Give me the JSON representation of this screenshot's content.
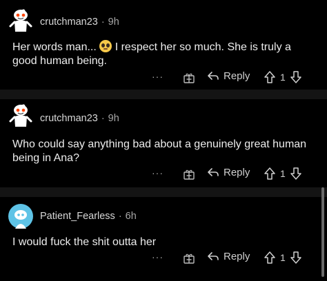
{
  "comments": [
    {
      "username": "crutchman23",
      "separator": "·",
      "time": "9h",
      "text_before": "Her words man...",
      "emoji": "pleading-face",
      "text_after": " I respect her so much. She is truly a good human being.",
      "reply_label": "Reply",
      "vote_count": "1",
      "more_label": "···",
      "avatar": "snoo-avatar-red-eyes"
    },
    {
      "username": "crutchman23",
      "separator": "·",
      "time": "9h",
      "text": "Who could say anything bad about a genuinely great human being in Ana?",
      "reply_label": "Reply",
      "vote_count": "1",
      "more_label": "···",
      "avatar": "snoo-avatar-red-eyes"
    },
    {
      "username": "Patient_Fearless",
      "separator": "·",
      "time": "6h",
      "text": "I would fuck the shit outta her",
      "reply_label": "Reply",
      "vote_count": "1",
      "more_label": "···",
      "avatar": "default-avatar-blue"
    }
  ],
  "colors": {
    "background": "#000000",
    "divider": "#141414",
    "text": "#ededed",
    "muted": "#a8a8a8",
    "avatar_blue": "#5ec3e6"
  }
}
